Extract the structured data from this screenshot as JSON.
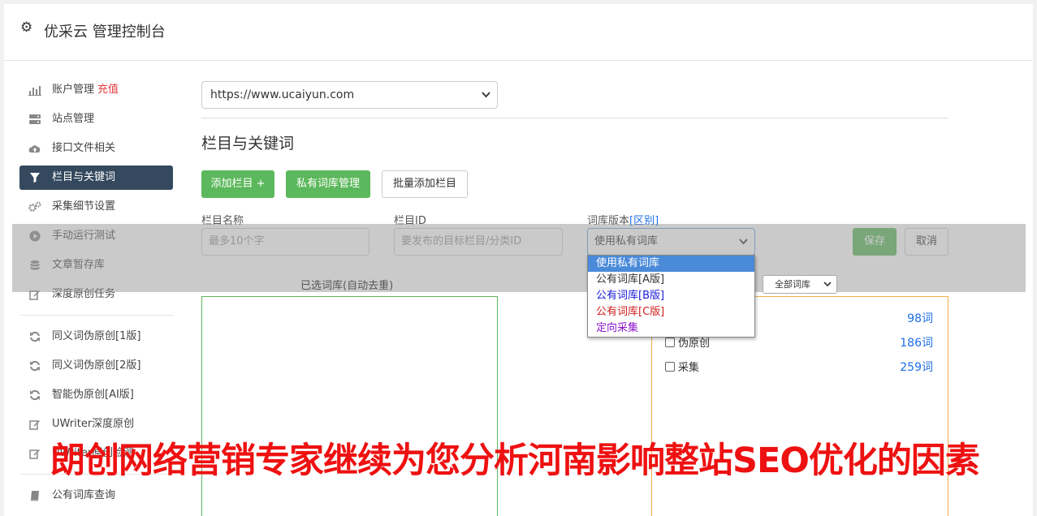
{
  "header": {
    "title": "优采云 管理控制台"
  },
  "sidebar": {
    "items": [
      {
        "label": "账户管理",
        "badge": "充值"
      },
      {
        "label": "站点管理"
      },
      {
        "label": "接口文件相关"
      },
      {
        "label": "栏目与关键词"
      },
      {
        "label": "采集细节设置"
      },
      {
        "label": "手动运行测试"
      },
      {
        "label": "文章暂存库"
      },
      {
        "label": "深度原创任务"
      },
      {
        "label": "同义词伪原创[1版]"
      },
      {
        "label": "同义词伪原创[2版]"
      },
      {
        "label": "智能伪原创[AI版]"
      },
      {
        "label": "UWriter深度原创"
      },
      {
        "label": "UWriter原创检测"
      },
      {
        "label": "公有词库查询"
      }
    ]
  },
  "main": {
    "site_select": "https://www.ucaiyun.com",
    "section_title": "栏目与关键词",
    "buttons": {
      "add_column": "添加栏目 +",
      "private_lib": "私有词库管理",
      "batch_add": "批量添加栏目"
    },
    "form": {
      "name_label": "栏目名称",
      "name_placeholder": "最多10个字",
      "id_label": "栏目ID",
      "id_placeholder": "要发布的目标栏目/分类ID",
      "lib_label": "词库版本",
      "lib_link": "[区别]",
      "lib_value": "使用私有词库",
      "save": "保存",
      "cancel": "取消"
    },
    "dropdown_options": [
      "使用私有词库",
      "公有词库[A版]",
      "公有词库[B版]",
      "公有词库[C版]",
      "定向采集"
    ],
    "selected_caption": "已选词库(自动去重)",
    "filter_select": "全部词库",
    "libraries": [
      {
        "name": "",
        "count": "98词"
      },
      {
        "name": "伪原创",
        "count": "186词"
      },
      {
        "name": "采集",
        "count": "259词"
      }
    ]
  },
  "banner": "朗创网络营销专家继续为您分析河南影响整站SEO优化的因素",
  "colors": {
    "accent_green": "#5cb85c",
    "active_nav": "#34495e",
    "link_blue": "#1c6ee8",
    "banner_red": "#ee1111"
  }
}
